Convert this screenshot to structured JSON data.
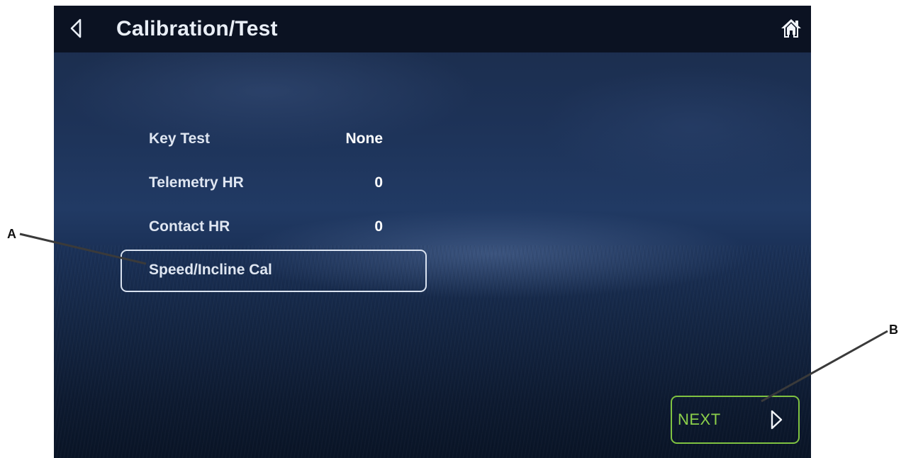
{
  "header": {
    "title": "Calibration/Test",
    "back_icon": "chevron-left-outline-icon",
    "home_icon": "home-icon"
  },
  "rows": [
    {
      "label": "Key Test",
      "value": "None"
    },
    {
      "label": "Telemetry HR",
      "value": "0"
    },
    {
      "label": "Contact HR",
      "value": "0"
    }
  ],
  "calibration": {
    "label": "Speed/Incline Cal"
  },
  "next_button": {
    "label": "NEXT",
    "icon": "chevron-right-outline-icon"
  },
  "callouts": {
    "a": "A",
    "b": "B"
  },
  "colors": {
    "header_bg": "#0b1222",
    "accent_green": "#7fc241",
    "text_light": "#dfe6f1"
  }
}
